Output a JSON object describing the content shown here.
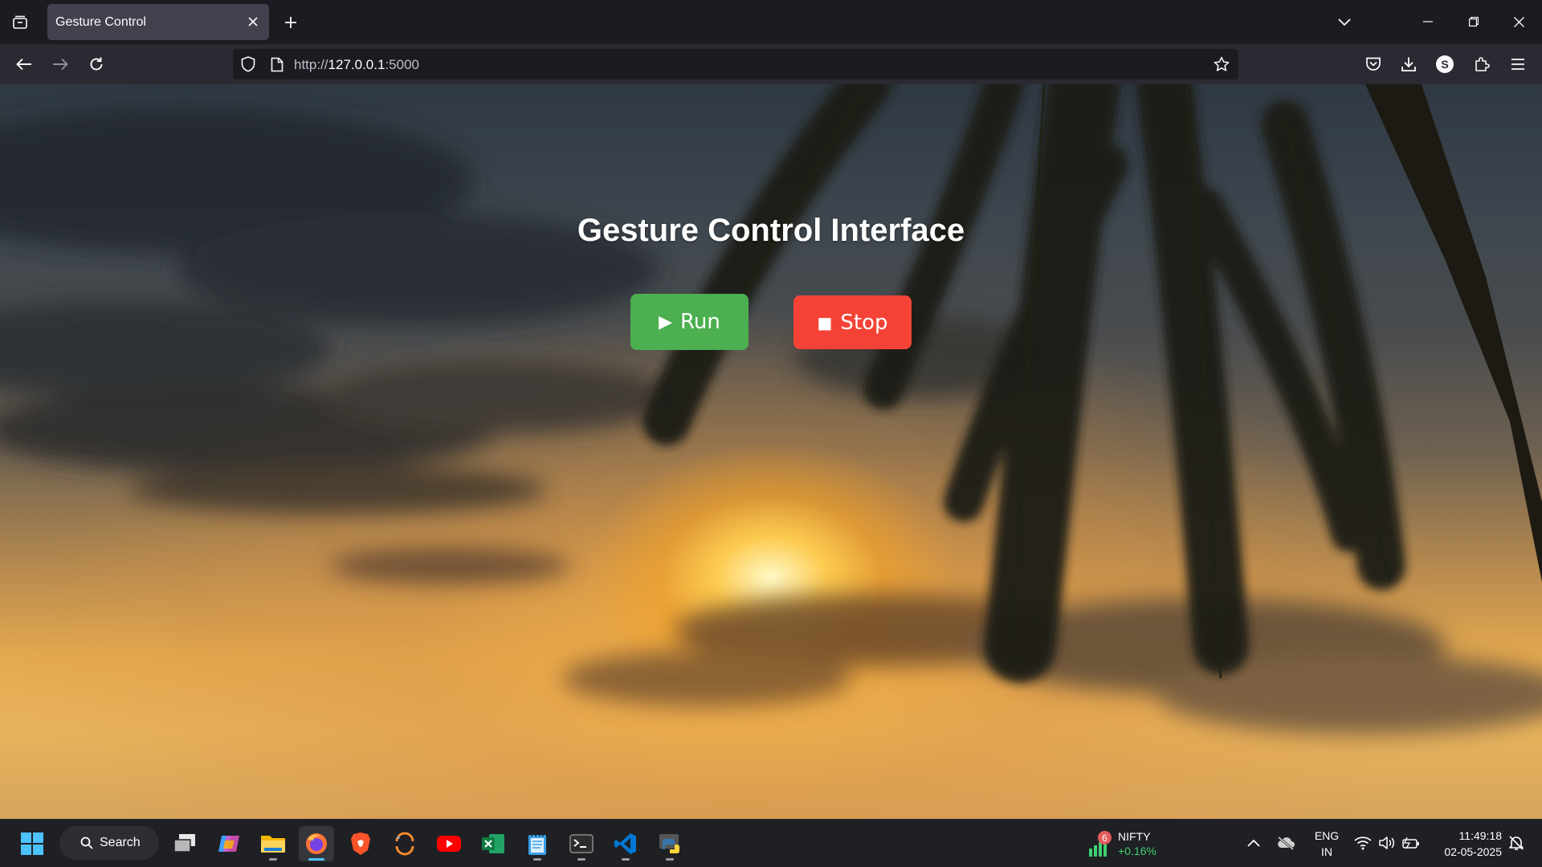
{
  "browser": {
    "tab": {
      "title": "Gesture Control"
    },
    "url": {
      "scheme": "http://",
      "host": "127.0.0.1",
      "port": ":5000"
    }
  },
  "page": {
    "title": "Gesture Control Interface",
    "run_button": {
      "icon": "▶",
      "label": "Run",
      "color": "#4caf50"
    },
    "stop_button": {
      "icon": "■",
      "label": "Stop",
      "color": "#f44336"
    }
  },
  "taskbar": {
    "search_label": "Search",
    "apps": [
      "task-view",
      "copilot",
      "file-explorer",
      "firefox",
      "brave",
      "app-orbit",
      "youtube",
      "excel",
      "notepad",
      "terminal",
      "vscode",
      "python"
    ],
    "nifty": {
      "badge": "6",
      "name": "NIFTY",
      "change": "+0.16%"
    },
    "language": {
      "line1": "ENG",
      "line2": "IN"
    },
    "clock": {
      "time": "11:49:18",
      "date": "02-05-2025"
    }
  }
}
